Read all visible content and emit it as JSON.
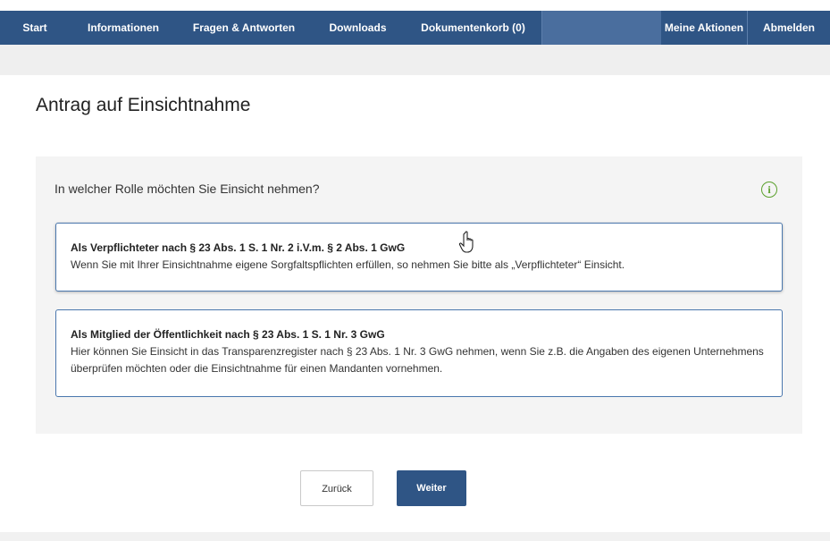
{
  "nav": {
    "items": [
      "Start",
      "Informationen",
      "Fragen & Antworten",
      "Downloads",
      "Dokumentenkorb (0)"
    ],
    "right": [
      "Meine Aktionen",
      "Abmelden"
    ]
  },
  "page": {
    "title": "Antrag auf Einsichtnahme"
  },
  "form": {
    "question": "In welcher Rolle möchten Sie Einsicht nehmen?",
    "info_icon": "info-icon",
    "options": [
      {
        "title": "Als Verpflichteter nach § 23 Abs. 1 S. 1 Nr. 2 i.V.m. § 2 Abs. 1 GwG",
        "description": "Wenn Sie mit Ihrer Einsichtnahme eigene Sorgfaltspflichten erfüllen, so nehmen Sie bitte als „Verpflichteter“ Einsicht."
      },
      {
        "title": "Als Mitglied der Öffentlichkeit nach § 23 Abs. 1 S. 1 Nr. 3 GwG",
        "description": "Hier können Sie Einsicht in das Transparenzregister nach § 23 Abs. 1 Nr. 3 GwG nehmen, wenn Sie z.B. die Angaben des eigenen Unternehmens überprüfen möchten oder die Einsichtnahme für einen Mandanten vornehmen."
      }
    ]
  },
  "actions": {
    "back": "Zurück",
    "next": "Weiter"
  },
  "colors": {
    "nav_bg": "#4a6e9e",
    "nav_dark": "#2f5585",
    "accent_border": "#4a77ad",
    "info_green": "#5aa02c"
  }
}
